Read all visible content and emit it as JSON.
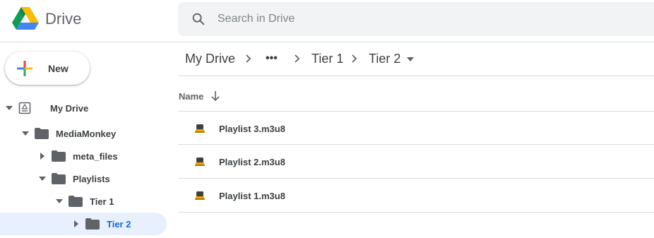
{
  "app": {
    "name": "Drive"
  },
  "search": {
    "placeholder": "Search in Drive",
    "value": ""
  },
  "new_button": {
    "label": "New"
  },
  "tree": {
    "my_drive": "My Drive",
    "mediamonkey": "MediaMonkey",
    "meta_files": "meta_files",
    "playlists": "Playlists",
    "tier1": "Tier 1",
    "tier2": "Tier 2"
  },
  "breadcrumb": {
    "root": "My Drive",
    "overflow": "•••",
    "tier1": "Tier 1",
    "current": "Tier 2"
  },
  "list": {
    "column_name": "Name",
    "files": [
      "Playlist 3.m3u8",
      "Playlist 2.m3u8",
      "Playlist 1.m3u8"
    ]
  },
  "colors": {
    "selected_bg": "#e8f0fe",
    "selected_text": "#1967d2",
    "folder": "#5f6368"
  }
}
